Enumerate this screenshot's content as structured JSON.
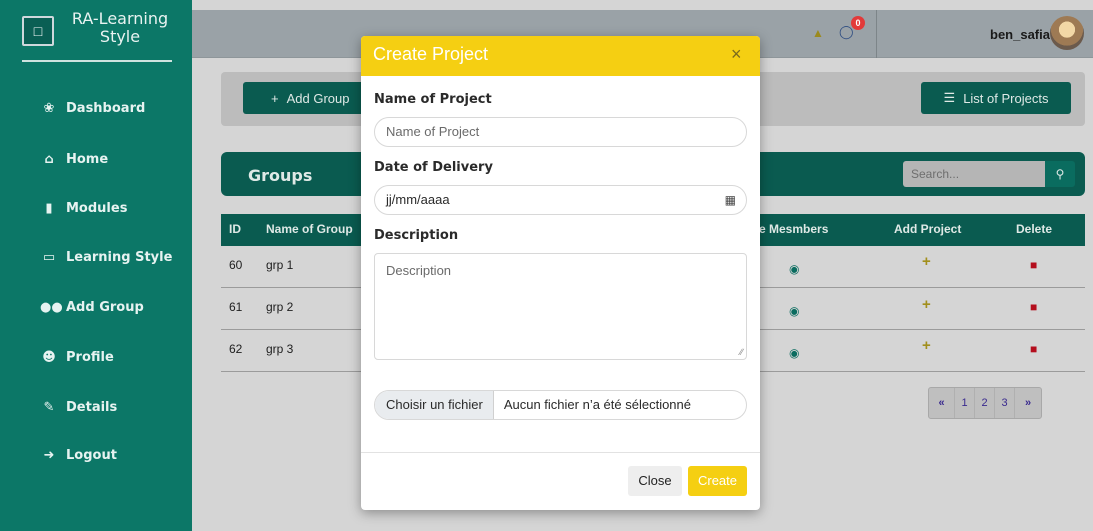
{
  "brand": {
    "title": "RA-Learning Style",
    "icon": "laptop-icon"
  },
  "sidebar": {
    "items": [
      {
        "label": "Dashboard",
        "icon": "dashboard-icon"
      },
      {
        "label": "Home",
        "icon": "home-icon"
      },
      {
        "label": "Modules",
        "icon": "book-icon"
      },
      {
        "label": "Learning Style",
        "icon": "laptop-icon"
      },
      {
        "label": "Add Group",
        "icon": "users-icon"
      },
      {
        "label": "Profile",
        "icon": "user-gear-icon"
      },
      {
        "label": "Details",
        "icon": "edit-icon"
      },
      {
        "label": "Logout",
        "icon": "logout-icon"
      }
    ]
  },
  "topbar": {
    "notifications_count": "0",
    "username": "ben_safia"
  },
  "toolbar": {
    "add_group_label": "Add Group",
    "list_projects_label": "List of Projects"
  },
  "groups": {
    "title": "Groups",
    "search_placeholder": "Search...",
    "columns": [
      "ID",
      "Name of Group",
      "e Mesmbers",
      "Add Project",
      "Delete"
    ],
    "rows": [
      {
        "id": "60",
        "name": "grp 1"
      },
      {
        "id": "61",
        "name": "grp 2"
      },
      {
        "id": "62",
        "name": "grp 3"
      }
    ],
    "pagination": [
      "«",
      "1",
      "2",
      "3",
      "»"
    ]
  },
  "modal": {
    "title": "Create Project",
    "close_symbol": "×",
    "name_label": "Name of Project",
    "name_placeholder": "Name of Project",
    "date_label": "Date of Delivery",
    "date_value": "jj/mm/aaaa",
    "description_label": "Description",
    "description_placeholder": "Description",
    "file_button": "Choisir un fichier",
    "file_status": "Aucun fichier n’a été sélectionné",
    "close_button": "Close",
    "create_button": "Create"
  },
  "colors": {
    "sidebar": "#0c7767",
    "accent_dark": "#0a5b50",
    "modal_header": "#f5cf12",
    "delete": "#b40e1d",
    "add": "#a28f1c"
  }
}
